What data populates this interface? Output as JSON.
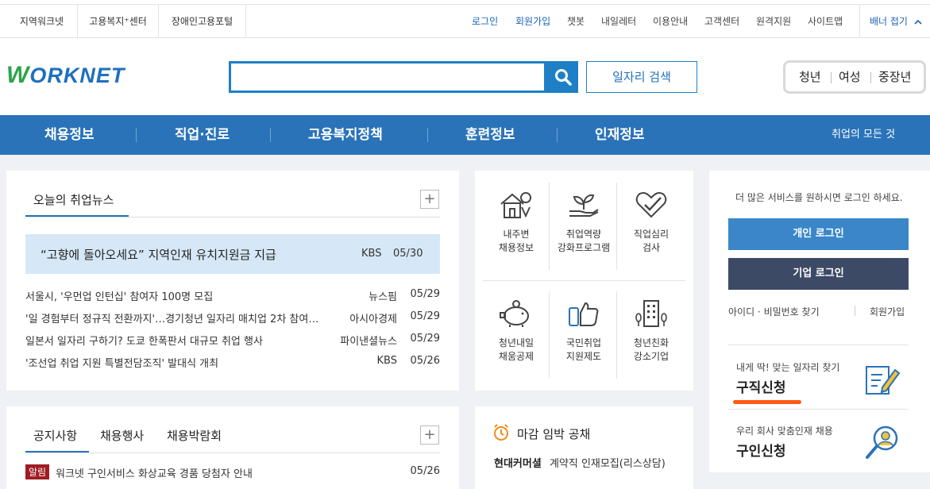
{
  "util": {
    "sites": [
      "지역워크넷",
      "고용복지⁺센터",
      "장애인고용포털"
    ],
    "links": [
      "로그인",
      "회원가입",
      "챗봇",
      "내일레터",
      "이용안내",
      "고객센터",
      "원격지원",
      "사이트맵"
    ],
    "banner_fold": "배너 접기"
  },
  "header": {
    "logo_w": "W",
    "logo_rest": "ORKNET",
    "search_placeholder": "",
    "job_search": "일자리 검색",
    "quick": [
      "청년",
      "여성",
      "중장년"
    ]
  },
  "gnb": {
    "items": [
      "채용정보",
      "직업·진로",
      "고용복지정책",
      "훈련정보",
      "인재정보"
    ],
    "all": "취업의 모든 것"
  },
  "news": {
    "title": "오늘의 취업뉴스",
    "plus": "+",
    "featured": {
      "title": "“고향에 돌아오세요” 지역인재 유치지원금 지급",
      "source": "KBS",
      "date": "05/30"
    },
    "items": [
      {
        "title": "서울시, '우먼업 인턴십' 참여자 100명 모집",
        "source": "뉴스핌",
        "date": "05/29"
      },
      {
        "title": "'일 경험부터 정규직 전환까지'…경기청년 일자리 매치업 2차 참여자 모집",
        "source": "아시아경제",
        "date": "05/29"
      },
      {
        "title": "일본서 일자리 구하기? 도쿄 한폭판서 대규모 취업 행사",
        "source": "파이낸셜뉴스",
        "date": "05/29"
      },
      {
        "title": "'조선업 취업 지원 특별전담조직' 발대식 개최",
        "source": "KBS",
        "date": "05/26"
      }
    ]
  },
  "services": [
    {
      "l1": "내주변",
      "l2": "채용정보",
      "icon": "house-pin-icon"
    },
    {
      "l1": "취업역량",
      "l2": "강화프로그램",
      "icon": "sprout-hand-icon"
    },
    {
      "l1": "직업심리",
      "l2": "검사",
      "icon": "heart-check-icon"
    },
    {
      "l1": "청년내일",
      "l2": "채움공제",
      "icon": "piggy-bank-icon"
    },
    {
      "l1": "국민취업",
      "l2": "지원제도",
      "icon": "thumbs-up-phone-icon"
    },
    {
      "l1": "청년친화",
      "l2": "강소기업",
      "icon": "building-icon"
    }
  ],
  "login": {
    "prompt": "더 많은 서비스를 원하시면 로그인 하세요.",
    "personal": "개인 로그인",
    "company": "기업 로그인",
    "find": "아이디 · 비밀번호 찾기",
    "join": "회원가입",
    "personal_color": "#3a86c8",
    "company_color": "#3d4a66"
  },
  "jobseek": {
    "sub": "내게 딱! 맞는 일자리 찾기",
    "title": "구직신청"
  },
  "recruit": {
    "sub": "우리 회사 맞춤인재 채용",
    "title": "구인신청"
  },
  "notice": {
    "tabs": [
      "공지사항",
      "채용행사",
      "채용박람회"
    ],
    "plus": "+",
    "item": {
      "badge": "알림",
      "title": "워크넷 구인서비스 화상교육 경품 당첨자 안내",
      "date": "05/26"
    }
  },
  "deadline": {
    "title": "마감 임박 공채",
    "company": "현대커머셜",
    "job": "계약직 인재모집(리스상담)"
  }
}
